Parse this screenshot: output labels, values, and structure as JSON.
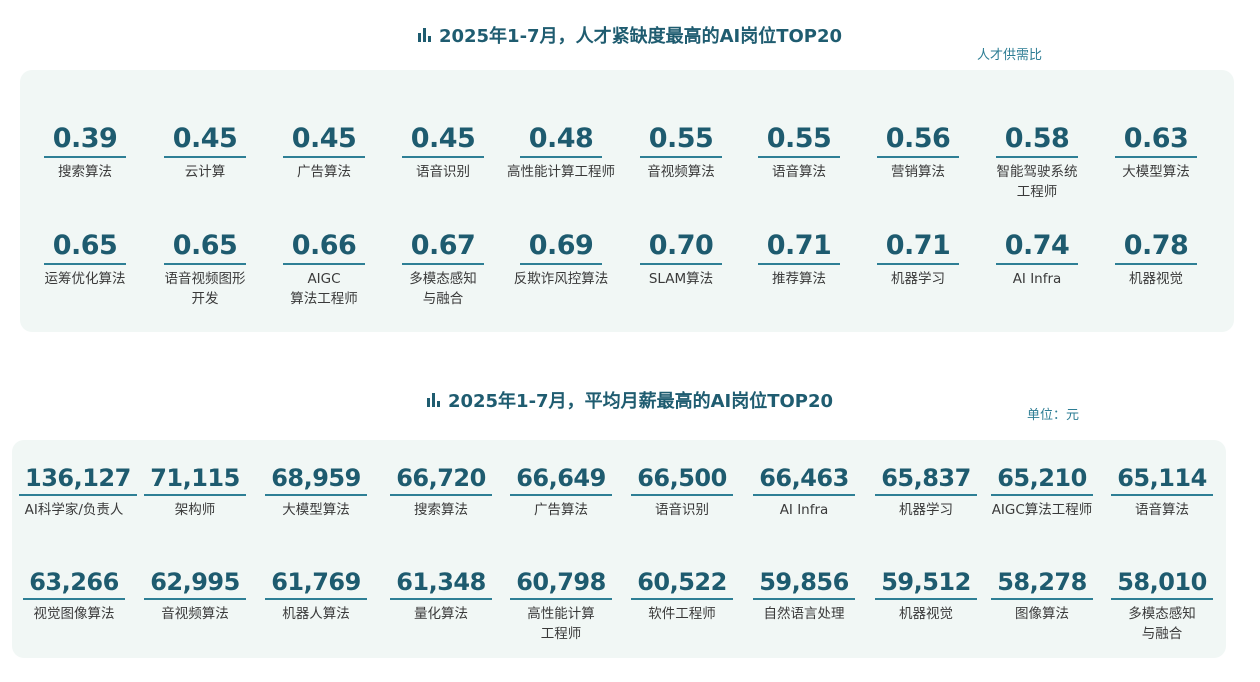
{
  "section1": {
    "title": "2025年1-7月，人才紧缺度最高的AI岗位TOP20",
    "unit": "人才供需比",
    "row1": [
      {
        "value": "0.39",
        "label": "搜索算法"
      },
      {
        "value": "0.45",
        "label": "云计算"
      },
      {
        "value": "0.45",
        "label": "广告算法"
      },
      {
        "value": "0.45",
        "label": "语音识别"
      },
      {
        "value": "0.48",
        "label": "高性能计算工程师"
      },
      {
        "value": "0.55",
        "label": "音视频算法"
      },
      {
        "value": "0.55",
        "label": "语音算法"
      },
      {
        "value": "0.56",
        "label": "营销算法"
      },
      {
        "value": "0.58",
        "label": "智能驾驶系统\n工程师"
      },
      {
        "value": "0.63",
        "label": "大模型算法"
      }
    ],
    "row2": [
      {
        "value": "0.65",
        "label": "运筹优化算法"
      },
      {
        "value": "0.65",
        "label": "语音视频图形\n开发"
      },
      {
        "value": "0.66",
        "label": "AIGC\n算法工程师"
      },
      {
        "value": "0.67",
        "label": "多模态感知\n与融合"
      },
      {
        "value": "0.69",
        "label": "反欺诈风控算法"
      },
      {
        "value": "0.70",
        "label": "SLAM算法"
      },
      {
        "value": "0.71",
        "label": "推荐算法"
      },
      {
        "value": "0.71",
        "label": "机器学习"
      },
      {
        "value": "0.74",
        "label": "AI Infra"
      },
      {
        "value": "0.78",
        "label": "机器视觉"
      }
    ]
  },
  "section2": {
    "title": "2025年1-7月，平均月薪最高的AI岗位TOP20",
    "unit": "单位：元",
    "row1": [
      {
        "value": "136,127",
        "label": "AI科学家/负责人"
      },
      {
        "value": "71,115",
        "label": "架构师"
      },
      {
        "value": "68,959",
        "label": "大模型算法"
      },
      {
        "value": "66,720",
        "label": "搜索算法"
      },
      {
        "value": "66,649",
        "label": "广告算法"
      },
      {
        "value": "66,500",
        "label": "语音识别"
      },
      {
        "value": "66,463",
        "label": "AI Infra"
      },
      {
        "value": "65,837",
        "label": "机器学习"
      },
      {
        "value": "65,210",
        "label": "AIGC算法工程师"
      },
      {
        "value": "65,114",
        "label": "语音算法"
      }
    ],
    "row2": [
      {
        "value": "63,266",
        "label": "视觉图像算法"
      },
      {
        "value": "62,995",
        "label": "音视频算法"
      },
      {
        "value": "61,769",
        "label": "机器人算法"
      },
      {
        "value": "61,348",
        "label": "量化算法"
      },
      {
        "value": "60,798",
        "label": "高性能计算\n工程师"
      },
      {
        "value": "60,522",
        "label": "软件工程师"
      },
      {
        "value": "59,856",
        "label": "自然语言处理"
      },
      {
        "value": "59,512",
        "label": "机器视觉"
      },
      {
        "value": "58,278",
        "label": "图像算法"
      },
      {
        "value": "58,010",
        "label": "多模态感知\n与融合"
      }
    ]
  }
}
